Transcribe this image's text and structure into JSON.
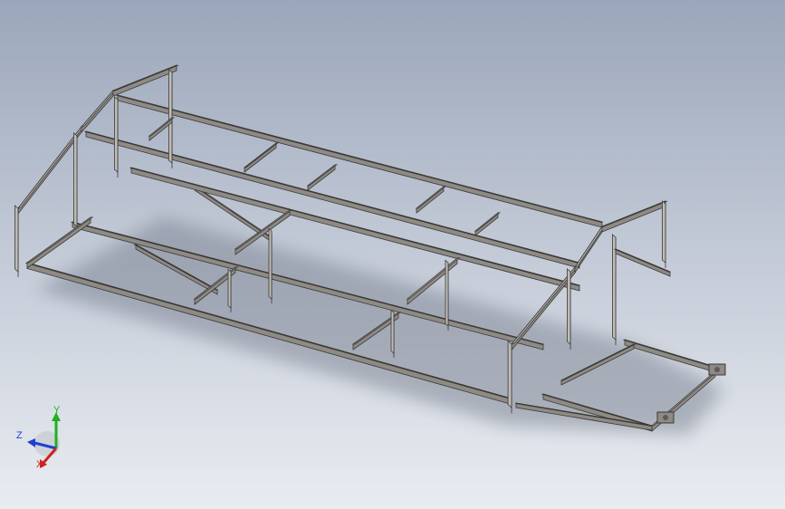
{
  "viewport": {
    "background_top": "#9aa6ba",
    "background_bottom": "#e9ecf1",
    "model": "steel-tube-frame"
  },
  "colors": {
    "tube_top": "#bfbcb7",
    "tube_side": "#8e8a85",
    "tube_dark": "#5e5b57",
    "edge": "#3b3936",
    "shadow": "#7f8796"
  },
  "triad": {
    "x_label": "X",
    "y_label": "Y",
    "z_label": "Z",
    "x_color": "#d02020",
    "y_color": "#20b020",
    "z_color": "#2040d0"
  }
}
